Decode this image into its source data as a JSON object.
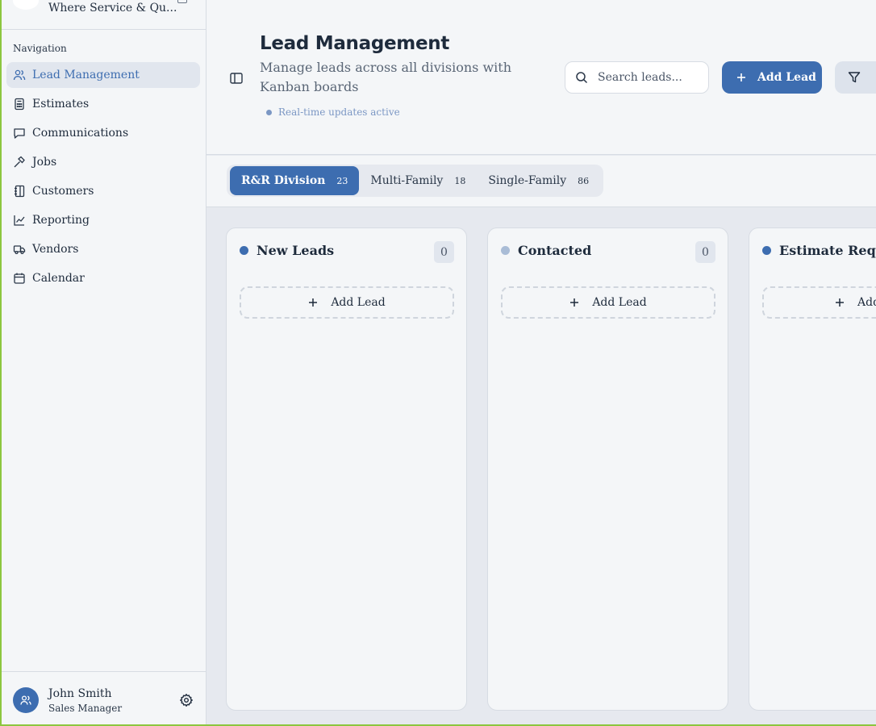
{
  "brand": {
    "subtitle": "Where Service & Qu..."
  },
  "sidebar": {
    "heading": "Navigation",
    "items": [
      {
        "label": "Lead Management",
        "icon": "users-icon",
        "active": true
      },
      {
        "label": "Estimates",
        "icon": "calculator-icon"
      },
      {
        "label": "Communications",
        "icon": "chat-icon"
      },
      {
        "label": "Jobs",
        "icon": "hammer-icon"
      },
      {
        "label": "Customers",
        "icon": "address-book-icon"
      },
      {
        "label": "Reporting",
        "icon": "line-chart-icon"
      },
      {
        "label": "Vendors",
        "icon": "truck-icon"
      },
      {
        "label": "Calendar",
        "icon": "calendar-icon"
      }
    ]
  },
  "user": {
    "name": "John Smith",
    "role": "Sales Manager"
  },
  "header": {
    "title": "Lead Management",
    "description": "Manage leads across all divisions with Kanban boards",
    "realtime": "Real-time updates active",
    "search_placeholder": "Search leads...",
    "add_label": "Add Lead"
  },
  "tabs": [
    {
      "label": "R&R Division",
      "count": "23",
      "active": true
    },
    {
      "label": "Multi-Family",
      "count": "18"
    },
    {
      "label": "Single-Family",
      "count": "86"
    }
  ],
  "columns": [
    {
      "title": "New Leads",
      "count": "0",
      "dot": "#3d6db0",
      "add_label": "Add Lead"
    },
    {
      "title": "Contacted",
      "count": "0",
      "dot": "#a9bcd6",
      "add_label": "Add Lead"
    },
    {
      "title": "Estimate Reques",
      "count": "",
      "dot": "#3d6db0",
      "add_label": "Add"
    }
  ],
  "colors": {
    "accent": "#3d6db0",
    "accent_light": "#a9bcd6",
    "muted": "#7b97c4"
  }
}
